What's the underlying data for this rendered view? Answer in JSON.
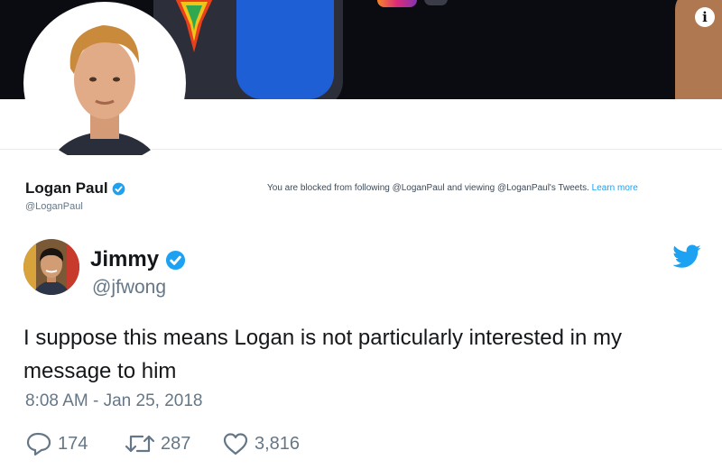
{
  "profile": {
    "name": "Logan Paul",
    "handle": "@LoganPaul",
    "blocked_text": "You are blocked from following @LoganPaul and viewing @LoganPaul's Tweets.",
    "learn_more": "Learn more"
  },
  "tweet": {
    "name": "Jimmy",
    "handle": "@jfwong",
    "text": "I suppose this means Logan is not particularly interested in my message to him",
    "timestamp": "8:08 AM - Jan 25, 2018",
    "replies": "174",
    "retweets": "287",
    "likes": "3,816"
  },
  "banner": {
    "info_glyph": "i"
  },
  "colors": {
    "twitter_blue": "#1da1f2",
    "muted_text": "#657786",
    "banner_bg": "#0b0c12"
  },
  "icons": [
    "info-icon",
    "verified-badge-icon",
    "twitter-bird-icon",
    "reply-icon",
    "retweet-icon",
    "like-icon"
  ]
}
